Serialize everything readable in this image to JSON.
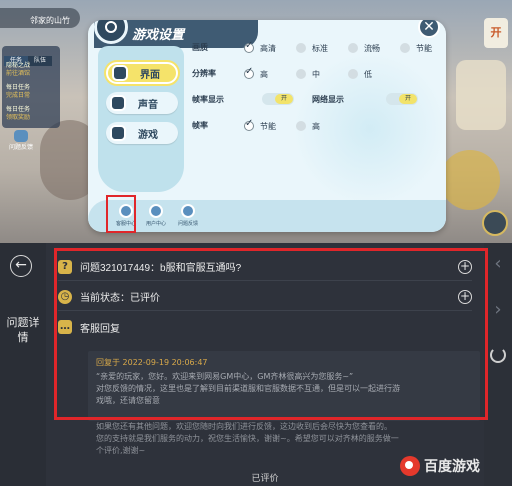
{
  "game": {
    "hud_top_text": "邻家的山竹",
    "hud_tabs": [
      "任务",
      "队伍"
    ],
    "tasks": [
      {
        "title": "隐秘之战",
        "sub": "前往酒馆"
      },
      {
        "title": "每日任务",
        "sub": "完成日常"
      },
      {
        "title": "每日任务",
        "sub": "领取奖励"
      }
    ],
    "feedback_label": "问题反馈",
    "right_badge": "开"
  },
  "dialog": {
    "title": "游戏设置",
    "close_glyph": "✕",
    "tabs": [
      {
        "label": "界面",
        "active": true
      },
      {
        "label": "声音",
        "active": false
      },
      {
        "label": "游戏",
        "active": false
      }
    ],
    "rows": {
      "quality": {
        "label": "画质",
        "options": [
          "高清",
          "标准",
          "流畅",
          "节能"
        ],
        "selected": "高清"
      },
      "resolution": {
        "label": "分辨率",
        "options": [
          "高",
          "中",
          "低"
        ],
        "selected": "高"
      },
      "fps_display": {
        "label": "帧率显示",
        "toggle": "开"
      },
      "net_display": {
        "label": "网络显示",
        "toggle": "开"
      },
      "fps": {
        "label": "帧率",
        "options": [
          "节能",
          "高"
        ],
        "selected": "节能"
      }
    },
    "footer_buttons": [
      "客服中心",
      "用户中心",
      "问题反馈"
    ]
  },
  "panel": {
    "side_title": "问题详情",
    "question": "问题321017449：b服和官服互通吗?",
    "status": "当前状态：已评价",
    "reply_header": "客服回复",
    "reply_time": "回复于 2022-09-19 20:06:47",
    "reply_lines": [
      "“亲爱的玩家，您好。欢迎来到网易GM中心，GM齐林很高兴为您服务~”",
      "对您反馈的情况，这里也是了解到目前渠道服和官服数据不互通，但是可以一起进行游",
      "戏哦，还请您留意"
    ],
    "reply_more": [
      "如果您还有其他问题，欢迎您随时向我们进行反馈，这边收到后会尽快为您查看的。",
      "您的支持就是我们服务的动力，祝您生活愉快，谢谢~。希望您可以对齐林的服务做一",
      "个评价,谢谢~"
    ],
    "bottom_status": "已评价"
  },
  "watermark": "百度游戏",
  "colors": {
    "highlight_red": "#e0262a",
    "accent_yellow": "#f5e36a",
    "gold": "#d8b44a"
  }
}
